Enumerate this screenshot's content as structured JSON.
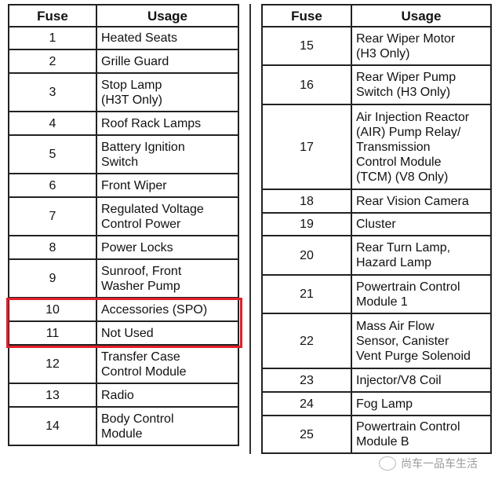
{
  "left_table": {
    "headers": [
      "Fuse",
      "Usage"
    ],
    "rows": [
      {
        "fuse": "1",
        "usage": [
          "Heated Seats"
        ]
      },
      {
        "fuse": "2",
        "usage": [
          "Grille Guard"
        ]
      },
      {
        "fuse": "3",
        "usage": [
          "Stop Lamp",
          "(H3T Only)"
        ]
      },
      {
        "fuse": "4",
        "usage": [
          "Roof Rack Lamps"
        ]
      },
      {
        "fuse": "5",
        "usage": [
          "Battery Ignition",
          "Switch"
        ]
      },
      {
        "fuse": "6",
        "usage": [
          "Front Wiper"
        ]
      },
      {
        "fuse": "7",
        "usage": [
          "Regulated Voltage",
          "Control Power"
        ]
      },
      {
        "fuse": "8",
        "usage": [
          "Power Locks"
        ]
      },
      {
        "fuse": "9",
        "usage": [
          "Sunroof, Front",
          "Washer Pump"
        ]
      },
      {
        "fuse": "10",
        "usage": [
          "Accessories (SPO)"
        ]
      },
      {
        "fuse": "11",
        "usage": [
          "Not Used"
        ]
      },
      {
        "fuse": "12",
        "usage": [
          "Transfer Case",
          "Control Module"
        ]
      },
      {
        "fuse": "13",
        "usage": [
          "Radio"
        ]
      },
      {
        "fuse": "14",
        "usage": [
          "Body Control",
          "Module"
        ]
      }
    ]
  },
  "right_table": {
    "headers": [
      "Fuse",
      "Usage"
    ],
    "rows": [
      {
        "fuse": "15",
        "usage": [
          "Rear Wiper Motor",
          "(H3 Only)"
        ]
      },
      {
        "fuse": "16",
        "usage": [
          "Rear Wiper Pump",
          "Switch (H3 Only)"
        ]
      },
      {
        "fuse": "17",
        "usage": [
          "Air Injection Reactor",
          "(AIR) Pump Relay/",
          "Transmission",
          "Control Module",
          "(TCM) (V8 Only)"
        ]
      },
      {
        "fuse": "18",
        "usage": [
          "Rear Vision Camera"
        ]
      },
      {
        "fuse": "19",
        "usage": [
          "Cluster"
        ]
      },
      {
        "fuse": "20",
        "usage": [
          "Rear Turn Lamp,",
          "Hazard Lamp"
        ]
      },
      {
        "fuse": "21",
        "usage": [
          "Powertrain Control",
          "Module 1"
        ]
      },
      {
        "fuse": "22",
        "usage": [
          "Mass Air Flow",
          "Sensor, Canister",
          "Vent Purge Solenoid"
        ]
      },
      {
        "fuse": "23",
        "usage": [
          "Injector/V8 Coil"
        ]
      },
      {
        "fuse": "24",
        "usage": [
          "Fog Lamp"
        ]
      },
      {
        "fuse": "25",
        "usage": [
          "Powertrain Control",
          "Module B"
        ]
      }
    ]
  },
  "highlight": {
    "rows": [
      "10",
      "11"
    ],
    "color": "#e0202a"
  },
  "watermark": "尚车一品车生活"
}
